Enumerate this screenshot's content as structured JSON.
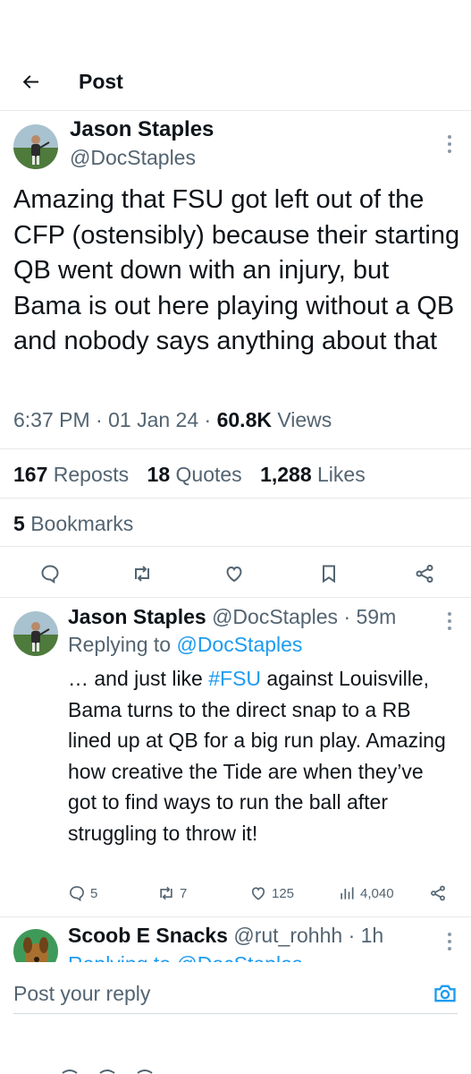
{
  "header": {
    "title": "Post"
  },
  "main_post": {
    "author_name": "Jason Staples",
    "author_handle": "@DocStaples",
    "text": "Amazing that FSU got left out of the CFP (ostensibly) because their starting QB went down with an injury, but Bama is out here playing without a QB and nobody says anything about that",
    "time": "6:37 PM",
    "date": "01 Jan 24",
    "dot": "·",
    "views_count": "60.8K",
    "views_label": "Views",
    "reposts_count": "167",
    "reposts_label": "Reposts",
    "quotes_count": "18",
    "quotes_label": "Quotes",
    "likes_count": "1,288",
    "likes_label": "Likes",
    "bookmarks_count": "5",
    "bookmarks_label": "Bookmarks"
  },
  "reply": {
    "author_name": "Jason Staples",
    "author_handle": "@DocStaples",
    "age": "59m",
    "replying_prefix": "Replying to",
    "replying_handle": "@DocStaples",
    "text_before": "… and just like ",
    "hashtag": "#FSU",
    "text_after": " against Louisville, Bama turns to the direct snap to a RB lined up at QB for a big run play. Amazing how creative the Tide are when they’ve got to find ways to run the ball after struggling to throw it!",
    "reply_count": "5",
    "repost_count": "7",
    "like_count": "125",
    "view_count": "4,040"
  },
  "reply2": {
    "author_name": "Scoob E Snacks",
    "author_handle": "@rut_rohhh",
    "age": "1h",
    "replying_text": "Replying to @DocStaples"
  },
  "composer": {
    "placeholder": "Post your reply"
  },
  "icons": {
    "back": "arrow-left-icon",
    "more": "more-vertical-icon",
    "reply": "comment-icon",
    "repost": "repost-icon",
    "like": "heart-icon",
    "bookmark": "bookmark-icon",
    "share": "share-icon",
    "views": "bar-chart-icon",
    "camera": "camera-icon"
  },
  "colors": {
    "text": "#0f1419",
    "muted": "#536471",
    "link": "#1d9bf0",
    "border": "#e6e9eb"
  }
}
